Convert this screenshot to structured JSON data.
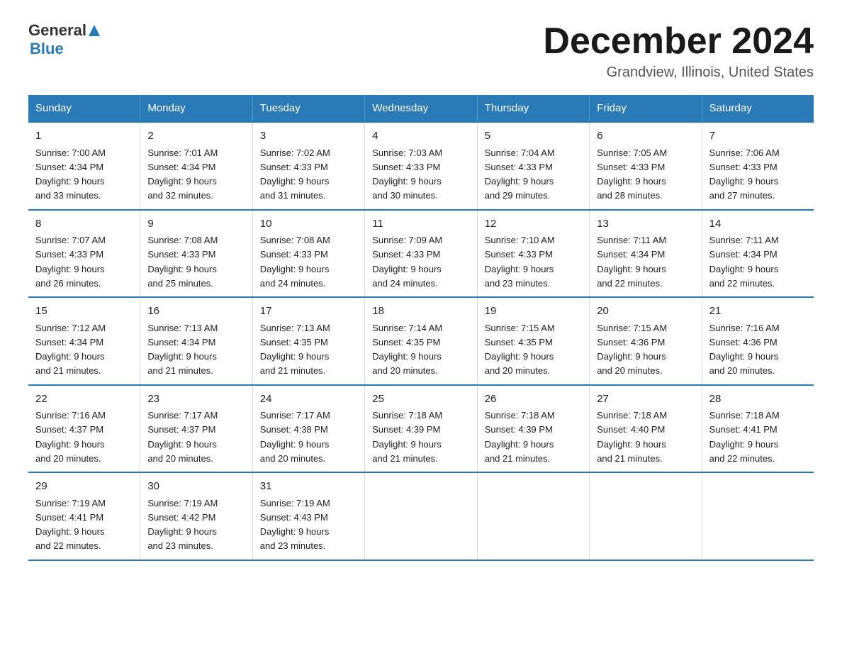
{
  "logo": {
    "text_general": "General",
    "text_blue": "Blue",
    "alt": "GeneralBlue logo"
  },
  "title": "December 2024",
  "subtitle": "Grandview, Illinois, United States",
  "days_of_week": [
    "Sunday",
    "Monday",
    "Tuesday",
    "Wednesday",
    "Thursday",
    "Friday",
    "Saturday"
  ],
  "weeks": [
    [
      {
        "num": "1",
        "sunrise": "7:00 AM",
        "sunset": "4:34 PM",
        "daylight": "9 hours and 33 minutes."
      },
      {
        "num": "2",
        "sunrise": "7:01 AM",
        "sunset": "4:34 PM",
        "daylight": "9 hours and 32 minutes."
      },
      {
        "num": "3",
        "sunrise": "7:02 AM",
        "sunset": "4:33 PM",
        "daylight": "9 hours and 31 minutes."
      },
      {
        "num": "4",
        "sunrise": "7:03 AM",
        "sunset": "4:33 PM",
        "daylight": "9 hours and 30 minutes."
      },
      {
        "num": "5",
        "sunrise": "7:04 AM",
        "sunset": "4:33 PM",
        "daylight": "9 hours and 29 minutes."
      },
      {
        "num": "6",
        "sunrise": "7:05 AM",
        "sunset": "4:33 PM",
        "daylight": "9 hours and 28 minutes."
      },
      {
        "num": "7",
        "sunrise": "7:06 AM",
        "sunset": "4:33 PM",
        "daylight": "9 hours and 27 minutes."
      }
    ],
    [
      {
        "num": "8",
        "sunrise": "7:07 AM",
        "sunset": "4:33 PM",
        "daylight": "9 hours and 26 minutes."
      },
      {
        "num": "9",
        "sunrise": "7:08 AM",
        "sunset": "4:33 PM",
        "daylight": "9 hours and 25 minutes."
      },
      {
        "num": "10",
        "sunrise": "7:08 AM",
        "sunset": "4:33 PM",
        "daylight": "9 hours and 24 minutes."
      },
      {
        "num": "11",
        "sunrise": "7:09 AM",
        "sunset": "4:33 PM",
        "daylight": "9 hours and 24 minutes."
      },
      {
        "num": "12",
        "sunrise": "7:10 AM",
        "sunset": "4:33 PM",
        "daylight": "9 hours and 23 minutes."
      },
      {
        "num": "13",
        "sunrise": "7:11 AM",
        "sunset": "4:34 PM",
        "daylight": "9 hours and 22 minutes."
      },
      {
        "num": "14",
        "sunrise": "7:11 AM",
        "sunset": "4:34 PM",
        "daylight": "9 hours and 22 minutes."
      }
    ],
    [
      {
        "num": "15",
        "sunrise": "7:12 AM",
        "sunset": "4:34 PM",
        "daylight": "9 hours and 21 minutes."
      },
      {
        "num": "16",
        "sunrise": "7:13 AM",
        "sunset": "4:34 PM",
        "daylight": "9 hours and 21 minutes."
      },
      {
        "num": "17",
        "sunrise": "7:13 AM",
        "sunset": "4:35 PM",
        "daylight": "9 hours and 21 minutes."
      },
      {
        "num": "18",
        "sunrise": "7:14 AM",
        "sunset": "4:35 PM",
        "daylight": "9 hours and 20 minutes."
      },
      {
        "num": "19",
        "sunrise": "7:15 AM",
        "sunset": "4:35 PM",
        "daylight": "9 hours and 20 minutes."
      },
      {
        "num": "20",
        "sunrise": "7:15 AM",
        "sunset": "4:36 PM",
        "daylight": "9 hours and 20 minutes."
      },
      {
        "num": "21",
        "sunrise": "7:16 AM",
        "sunset": "4:36 PM",
        "daylight": "9 hours and 20 minutes."
      }
    ],
    [
      {
        "num": "22",
        "sunrise": "7:16 AM",
        "sunset": "4:37 PM",
        "daylight": "9 hours and 20 minutes."
      },
      {
        "num": "23",
        "sunrise": "7:17 AM",
        "sunset": "4:37 PM",
        "daylight": "9 hours and 20 minutes."
      },
      {
        "num": "24",
        "sunrise": "7:17 AM",
        "sunset": "4:38 PM",
        "daylight": "9 hours and 20 minutes."
      },
      {
        "num": "25",
        "sunrise": "7:18 AM",
        "sunset": "4:39 PM",
        "daylight": "9 hours and 21 minutes."
      },
      {
        "num": "26",
        "sunrise": "7:18 AM",
        "sunset": "4:39 PM",
        "daylight": "9 hours and 21 minutes."
      },
      {
        "num": "27",
        "sunrise": "7:18 AM",
        "sunset": "4:40 PM",
        "daylight": "9 hours and 21 minutes."
      },
      {
        "num": "28",
        "sunrise": "7:18 AM",
        "sunset": "4:41 PM",
        "daylight": "9 hours and 22 minutes."
      }
    ],
    [
      {
        "num": "29",
        "sunrise": "7:19 AM",
        "sunset": "4:41 PM",
        "daylight": "9 hours and 22 minutes."
      },
      {
        "num": "30",
        "sunrise": "7:19 AM",
        "sunset": "4:42 PM",
        "daylight": "9 hours and 23 minutes."
      },
      {
        "num": "31",
        "sunrise": "7:19 AM",
        "sunset": "4:43 PM",
        "daylight": "9 hours and 23 minutes."
      },
      null,
      null,
      null,
      null
    ]
  ],
  "labels": {
    "sunrise_prefix": "Sunrise: ",
    "sunset_prefix": "Sunset: ",
    "daylight_prefix": "Daylight: "
  }
}
